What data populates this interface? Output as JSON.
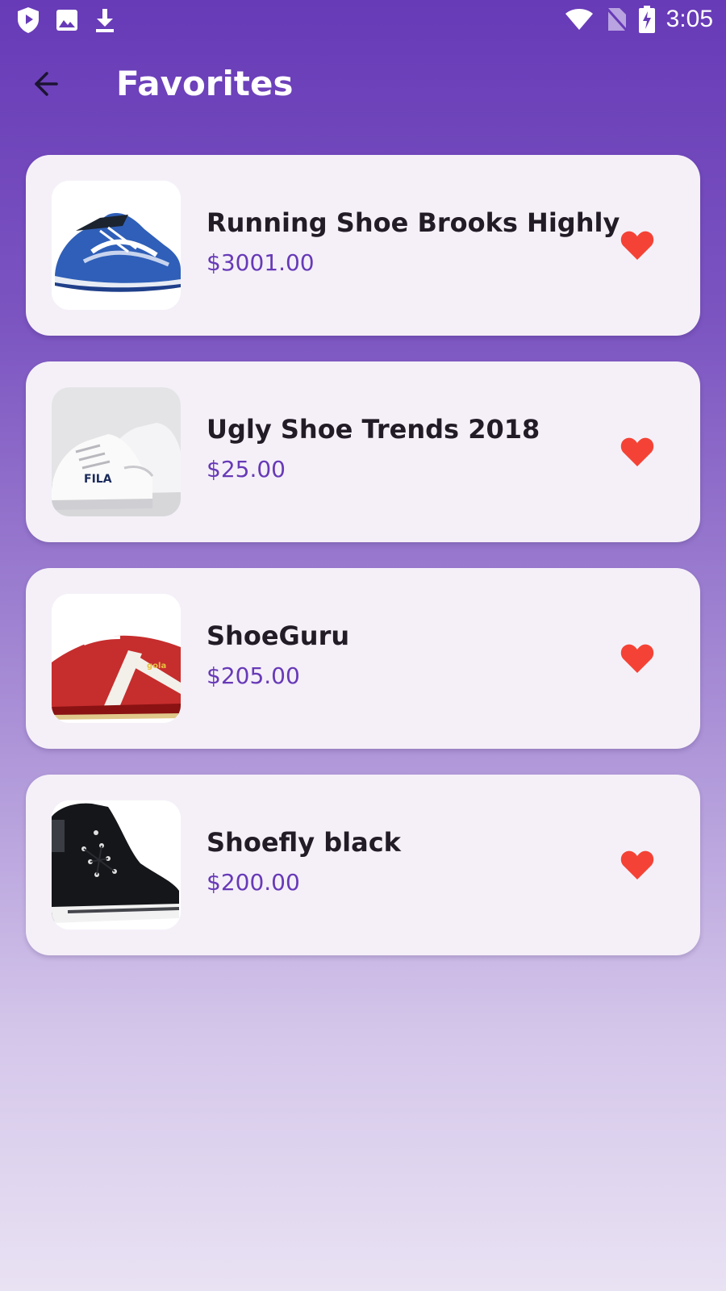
{
  "status_bar": {
    "time": "3:05",
    "left_icons": [
      "shield-icon",
      "image-icon",
      "download-icon"
    ],
    "right_icons": [
      "wifi-icon",
      "no-sim-icon",
      "battery-charging-icon"
    ]
  },
  "app_bar": {
    "title": "Favorites",
    "back_icon": "arrow-back-icon"
  },
  "favorites": [
    {
      "name": "Running Shoe Brooks Highly",
      "price": "$3001.00",
      "image": "blue-running-shoe"
    },
    {
      "name": "Ugly Shoe Trends 2018",
      "price": "$25.00",
      "image": "white-fila-sneaker"
    },
    {
      "name": "ShoeGuru",
      "price": "$205.00",
      "image": "red-white-sneaker"
    },
    {
      "name": "Shoefly black",
      "price": "$200.00",
      "image": "black-high-top-sneaker"
    }
  ],
  "colors": {
    "primary": "#673ab7",
    "heart": "#f44336",
    "card_background": "#f5f0f8",
    "text": "#211c26"
  }
}
